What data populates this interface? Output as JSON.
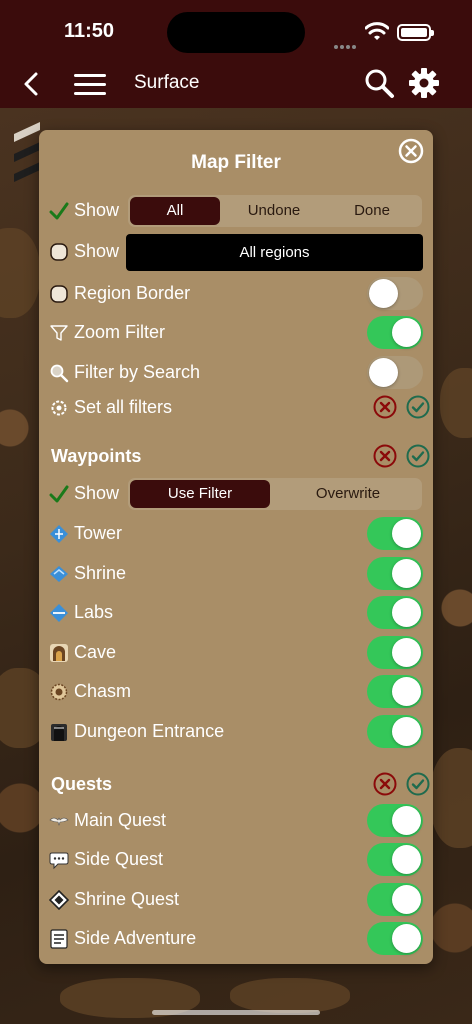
{
  "status": {
    "time": "11:50"
  },
  "nav": {
    "title": "Surface"
  },
  "panel": {
    "title": "Map Filter",
    "show_label": "Show",
    "show_options": [
      "All",
      "Undone",
      "Done"
    ],
    "show_selected": "All",
    "regions_label": "Show",
    "regions_value": "All regions",
    "general": [
      {
        "label": "Region Border",
        "on": false
      },
      {
        "label": "Zoom Filter",
        "on": true
      },
      {
        "label": "Filter by Search",
        "on": false
      }
    ],
    "set_all_label": "Set all filters",
    "waypoints": {
      "title": "Waypoints",
      "show_label": "Show",
      "options": [
        "Use Filter",
        "Overwrite"
      ],
      "selected": "Use Filter",
      "items": [
        {
          "label": "Tower",
          "icon": "tower-icon",
          "on": true
        },
        {
          "label": "Shrine",
          "icon": "shrine-icon",
          "on": true
        },
        {
          "label": "Labs",
          "icon": "labs-icon",
          "on": true
        },
        {
          "label": "Cave",
          "icon": "cave-icon",
          "on": true
        },
        {
          "label": "Chasm",
          "icon": "chasm-icon",
          "on": true
        },
        {
          "label": "Dungeon Entrance",
          "icon": "dungeon-icon",
          "on": true
        }
      ]
    },
    "quests": {
      "title": "Quests",
      "items": [
        {
          "label": "Main Quest",
          "icon": "main-quest-icon",
          "on": true
        },
        {
          "label": "Side Quest",
          "icon": "side-quest-icon",
          "on": true
        },
        {
          "label": "Shrine Quest",
          "icon": "shrine-quest-icon",
          "on": true
        },
        {
          "label": "Side Adventure",
          "icon": "side-adventure-icon",
          "on": true
        }
      ]
    }
  },
  "colors": {
    "header": "#3b0c0c",
    "panel": "#a98e67",
    "toggle_on": "#34c759",
    "reject": "#8b0a0a",
    "accept": "#1f6b4e"
  }
}
